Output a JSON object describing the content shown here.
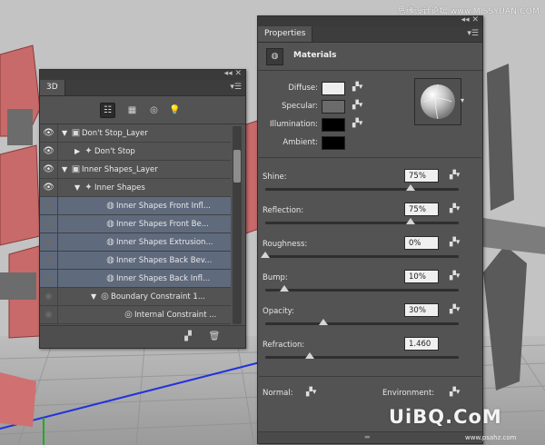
{
  "watermark_top": "思缘设计论坛 www.MISSYUAN.COM",
  "watermark_bottom": "UiBQ.CoM",
  "watermark_bottom_sub": "www.psahz.com",
  "panel_3d": {
    "tab": "3D",
    "layers": [
      {
        "label": "Don't Stop_Layer",
        "icon": "folder",
        "expanded": true,
        "selected": false,
        "visible": true
      },
      {
        "label": "Don't Stop",
        "icon": "mesh",
        "expanded": false,
        "selected": false,
        "visible": true
      },
      {
        "label": "Inner Shapes_Layer",
        "icon": "folder",
        "expanded": true,
        "selected": false,
        "visible": true
      },
      {
        "label": "Inner Shapes",
        "icon": "mesh",
        "expanded": true,
        "selected": false,
        "visible": true
      },
      {
        "label": "Inner Shapes Front Infl...",
        "icon": "material",
        "selected": true,
        "visible": false
      },
      {
        "label": "Inner Shapes Front Be...",
        "icon": "material",
        "selected": true,
        "visible": false
      },
      {
        "label": "Inner Shapes Extrusion...",
        "icon": "material",
        "selected": true,
        "visible": false
      },
      {
        "label": "Inner Shapes Back Bev...",
        "icon": "material",
        "selected": true,
        "visible": false
      },
      {
        "label": "Inner Shapes Back Infl...",
        "icon": "material",
        "selected": true,
        "visible": false
      },
      {
        "label": "Boundary Constraint 1...",
        "icon": "constraint",
        "expanded": true,
        "selected": false,
        "visible": false
      },
      {
        "label": "Internal Constraint ...",
        "icon": "constraint",
        "selected": false,
        "visible": false
      }
    ]
  },
  "panel_props": {
    "tab": "Properties",
    "header": "Materials",
    "swatches": [
      {
        "label": "Diffuse:",
        "color": "#eeeeee"
      },
      {
        "label": "Specular:",
        "color": "#6b6b6b"
      },
      {
        "label": "Illumination:",
        "color": "#000000"
      },
      {
        "label": "Ambient:",
        "color": "#000000"
      }
    ],
    "properties": [
      {
        "label": "Shine:",
        "value": "75%",
        "level": 0.75
      },
      {
        "label": "Reflection:",
        "value": "75%",
        "level": 0.75
      },
      {
        "label": "Roughness:",
        "value": "0%",
        "level": 0.0
      },
      {
        "label": "Bump:",
        "value": "10%",
        "level": 0.1
      },
      {
        "label": "Opacity:",
        "value": "30%",
        "level": 0.3
      },
      {
        "label": "Refraction:",
        "value": "1.460",
        "level": 0.23
      }
    ],
    "normal_label": "Normal:",
    "environment_label": "Environment:"
  }
}
